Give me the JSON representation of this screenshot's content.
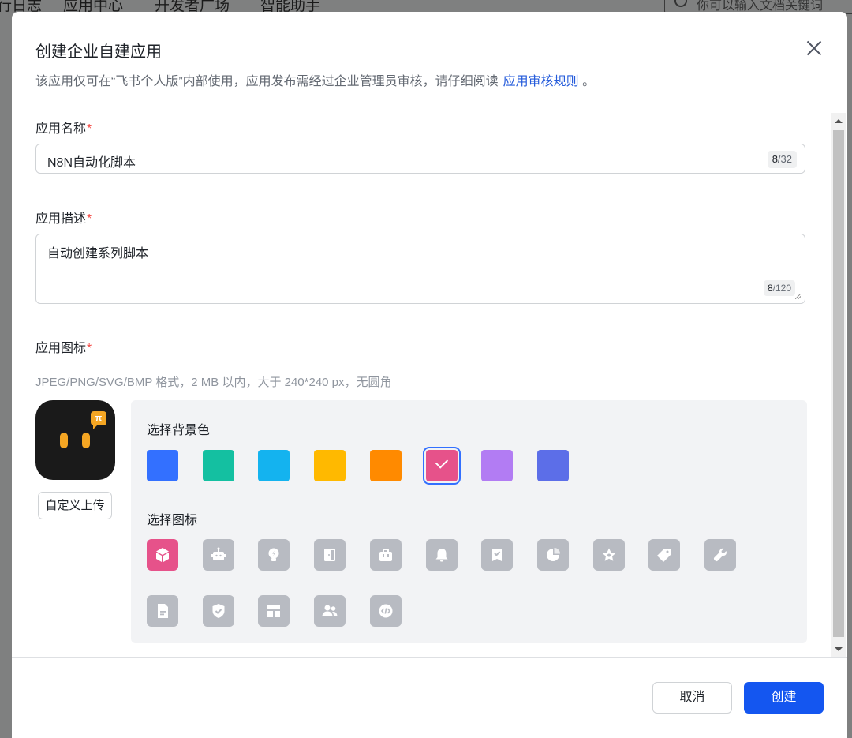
{
  "background": {
    "nav_items": [
      "行日志",
      "应用中心",
      "开发者广场",
      "智能助手"
    ],
    "search_placeholder": "你可以输入文档关键词"
  },
  "modal": {
    "title": "创建企业自建应用",
    "description": "该应用仅可在“飞书个人版”内部使用，应用发布需经过企业管理员审核，请仔细阅读",
    "rules_link": "应用审核规则",
    "description_end": "。",
    "name_field": {
      "label": "应用名称",
      "value": "N8N自动化脚本",
      "count": "8",
      "max": "/32"
    },
    "desc_field": {
      "label": "应用描述",
      "value": "自动创建系列脚本",
      "count": "8",
      "max": "/120"
    },
    "icon_field": {
      "label": "应用图标",
      "required_mark": "*",
      "hint": "JPEG/PNG/SVG/BMP 格式，2 MB 以内，大于 240*240 px，无圆角",
      "upload_label": "自定义上传",
      "preview_badge": "π",
      "bg_color_title": "选择背景色",
      "icon_title": "选择图标",
      "bg_colors": [
        "#3370ff",
        "#14c0a1",
        "#14b3ef",
        "#ffb900",
        "#ff8a00",
        "#e6528a",
        "#b27cf3",
        "#5c6ee8"
      ],
      "selected_bg_color": "#e6528a",
      "icons": [
        "cube-icon",
        "robot-icon",
        "lightbulb-icon",
        "door-icon",
        "briefcase-icon",
        "bell-icon",
        "checklist-icon",
        "pie-chart-icon",
        "star-icon",
        "tag-icon",
        "wrench-icon",
        "document-icon",
        "shield-check-icon",
        "layout-icon",
        "users-icon",
        "code-icon"
      ],
      "selected_icon": "cube-icon"
    },
    "buttons": {
      "cancel": "取消",
      "create": "创建"
    }
  }
}
